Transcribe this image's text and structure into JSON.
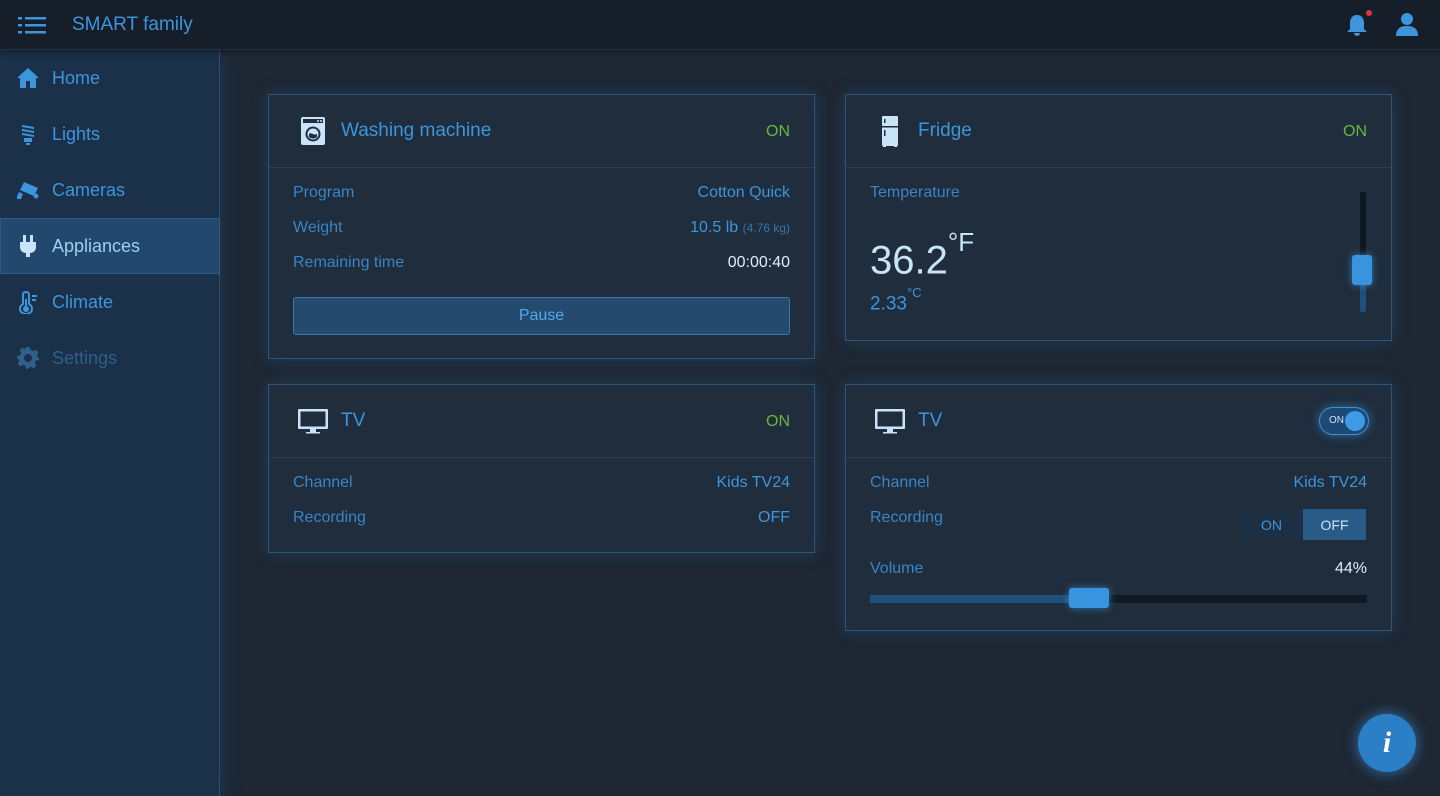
{
  "app": {
    "title": "SMART family"
  },
  "topbar": {
    "menu_icon": "hamburger-menu-icon",
    "bell_icon": "bell-icon",
    "user_icon": "user-icon"
  },
  "sidebar": {
    "items": [
      {
        "label": "Home",
        "icon": "home-icon"
      },
      {
        "label": "Lights",
        "icon": "bulb-icon"
      },
      {
        "label": "Cameras",
        "icon": "camera-icon"
      },
      {
        "label": "Appliances",
        "icon": "plug-icon",
        "active": true
      },
      {
        "label": "Climate",
        "icon": "thermometer-icon"
      },
      {
        "label": "Settings",
        "icon": "gear-icon",
        "disabled": true
      }
    ]
  },
  "washing": {
    "title": "Washing machine",
    "status": "ON",
    "rows": [
      {
        "label": "Program",
        "value": "Cotton Quick"
      },
      {
        "label": "Weight",
        "value": "10.5 lb",
        "sub": "(4.76 kg)"
      },
      {
        "label": "Remaining time",
        "value": "00:00:40"
      }
    ],
    "pause_label": "Pause"
  },
  "fridge": {
    "title": "Fridge",
    "status": "ON",
    "temp_label": "Temperature",
    "temp_f": "36.2",
    "unit_f": "°F",
    "temp_c": "2.33",
    "unit_c": "°C",
    "slider_level": 0.3
  },
  "tv1": {
    "title": "TV",
    "status": "ON",
    "rows": [
      {
        "label": "Channel",
        "value": "Kids TV24"
      },
      {
        "label": "Recording",
        "value": "OFF"
      }
    ]
  },
  "tv2": {
    "title": "TV",
    "toggle_label": "ON",
    "rows": [
      {
        "label": "Channel",
        "value": "Kids TV24"
      },
      {
        "label": "Recording"
      },
      {
        "label": "Volume",
        "value": "44%"
      }
    ],
    "recording_options": [
      "ON",
      "OFF"
    ],
    "recording_selected": "OFF",
    "volume_level": 0.44
  },
  "colors": {
    "accent": "#3d95dc",
    "status_on": "#67b63e",
    "background": "#1e2733"
  }
}
